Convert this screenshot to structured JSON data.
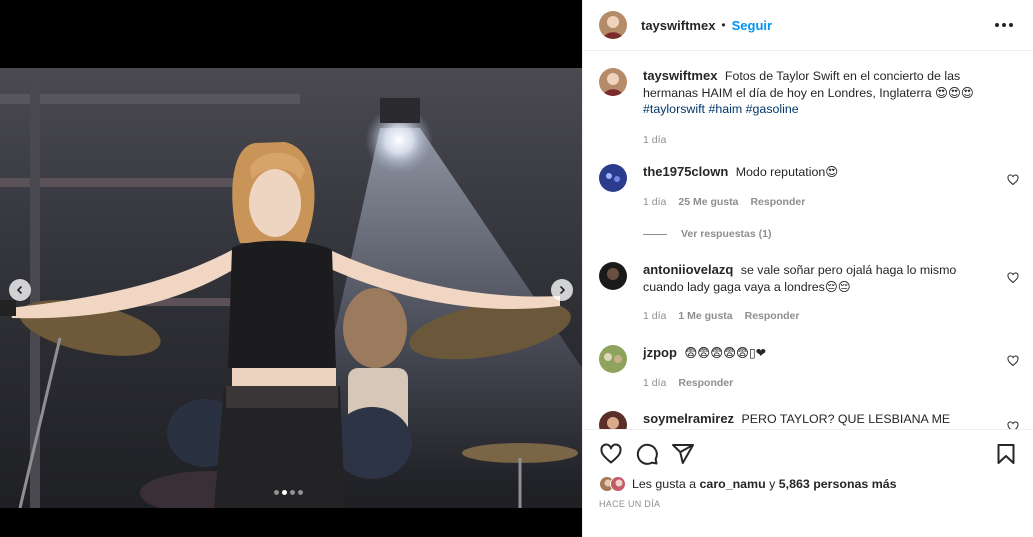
{
  "post": {
    "username": "tayswiftmex",
    "separator": "•",
    "follow_label": "Seguir",
    "more_icon": "more-options-icon",
    "caption": {
      "username": "tayswiftmex",
      "text": "Fotos de Taylor Swift en el concierto de las hermanas HAIM el día de hoy en Londres, Inglaterra 😍😍😍",
      "hashtags": [
        "#taylorswift",
        "#haim",
        "#gasoline"
      ],
      "time": "1 día"
    }
  },
  "media": {
    "carousel_count": 4,
    "active_index": 1,
    "colors": {
      "background": "#000000",
      "nav_button": "#ffffff"
    }
  },
  "comments": [
    {
      "username": "the1975clown",
      "text": "Modo reputation😍",
      "time": "1 día",
      "likes": "25 Me gusta",
      "reply_label": "Responder",
      "view_replies": "Ver respuestas (1)"
    },
    {
      "username": "antoniiovelazq",
      "text": "se vale soñar pero ojalá haga lo mismo cuando lady gaga vaya a londres😔😔",
      "time": "1 día",
      "likes": "1 Me gusta",
      "reply_label": "Responder"
    },
    {
      "username": "jzpop",
      "text": "😨😨😨😨😨▯❤",
      "time": "1 día",
      "reply_label": "Responder"
    },
    {
      "username": "soymelramirez",
      "text": "PERO TAYLOR? QUE LESBIANA ME SIENTO"
    }
  ],
  "actions": {
    "icons": [
      "heart-icon",
      "comment-icon",
      "share-icon",
      "bookmark-icon"
    ]
  },
  "likes": {
    "prefix": "Les gusta a",
    "user": "caro_namu",
    "middle": "y",
    "count": "5,863 personas más"
  },
  "timestamp": "HACE UN DÍA",
  "colors": {
    "link": "#0095f6",
    "hashtag": "#00376b",
    "muted": "#8e8e8e",
    "text": "#262626"
  }
}
